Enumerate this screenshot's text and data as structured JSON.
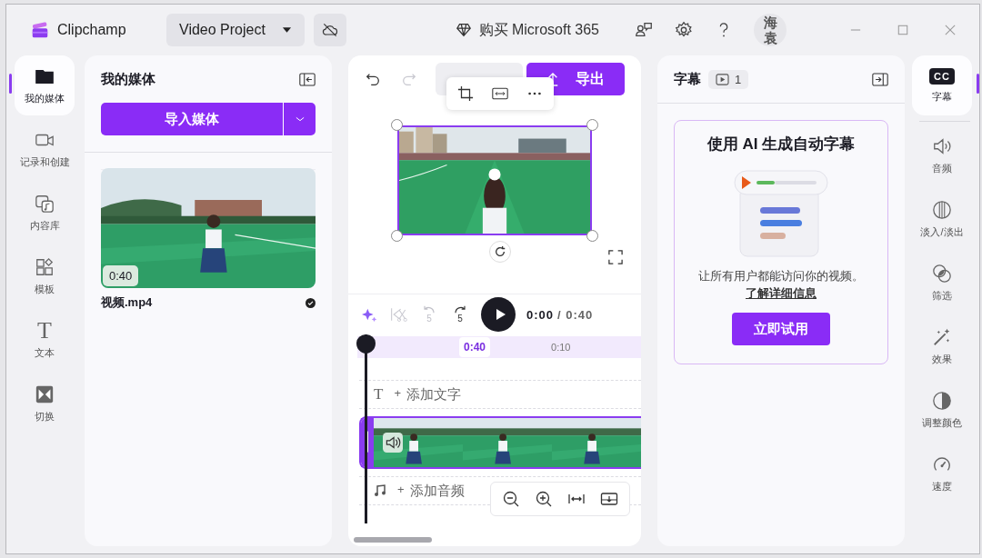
{
  "app": {
    "name": "Clipchamp"
  },
  "project": {
    "name": "Video Project"
  },
  "promo": {
    "label": "购买 Microsoft 365"
  },
  "account": {
    "initials": "海袁"
  },
  "left_rail": [
    {
      "label": "我的媒体",
      "kind": "folder",
      "selected": true
    },
    {
      "label": "记录和创建",
      "kind": "camera",
      "selected": false
    },
    {
      "label": "内容库",
      "kind": "library",
      "selected": false
    },
    {
      "label": "模板",
      "kind": "templates",
      "selected": false
    },
    {
      "label": "文本",
      "kind": "text",
      "glyph": "T",
      "selected": false
    },
    {
      "label": "切换",
      "kind": "transition",
      "selected": false
    }
  ],
  "media_panel": {
    "title": "我的媒体",
    "import_button": "导入媒体",
    "items": [
      {
        "name": "视频.mp4",
        "duration": "0:40",
        "checked": true
      }
    ]
  },
  "editor": {
    "undo": {
      "disabled": false
    },
    "redo": {
      "disabled": true
    },
    "export_button": "导出",
    "controls": [
      {
        "kind": "sparkle",
        "disabled": false
      },
      {
        "kind": "cut",
        "disabled": true
      },
      {
        "kind": "back",
        "label": "5",
        "disabled": true
      },
      {
        "kind": "forward",
        "label": "5",
        "disabled": false
      }
    ],
    "time_current": "0:00",
    "time_total": "/ 0:40",
    "ruler": [
      {
        "label": "0:40",
        "selected": true
      },
      {
        "label": "0:10",
        "selected": false
      }
    ],
    "tracks": [
      {
        "kind": "text",
        "glyph": "T",
        "plus": "+",
        "label": "添加文字"
      },
      {
        "kind": "video",
        "selected": true
      },
      {
        "kind": "audio",
        "plus": "+",
        "label": "添加音频"
      }
    ]
  },
  "captions_panel": {
    "title": "字幕",
    "count": "1",
    "card": {
      "title": "使用 AI 生成自动字幕",
      "text": "让所有用户都能访问你的视频。",
      "link": "了解详细信息",
      "button": "立即试用"
    }
  },
  "right_rail": [
    {
      "label": "字幕",
      "kind": "cc",
      "glyph": "CC",
      "selected": true
    },
    {
      "label": "音频",
      "kind": "audio",
      "selected": false
    },
    {
      "label": "淡入/淡出",
      "kind": "fade",
      "selected": false
    },
    {
      "label": "筛选",
      "kind": "filter",
      "selected": false
    },
    {
      "label": "效果",
      "kind": "effects",
      "selected": false
    },
    {
      "label": "调整颜色",
      "kind": "color",
      "selected": false
    },
    {
      "label": "速度",
      "kind": "speed",
      "selected": false
    }
  ]
}
